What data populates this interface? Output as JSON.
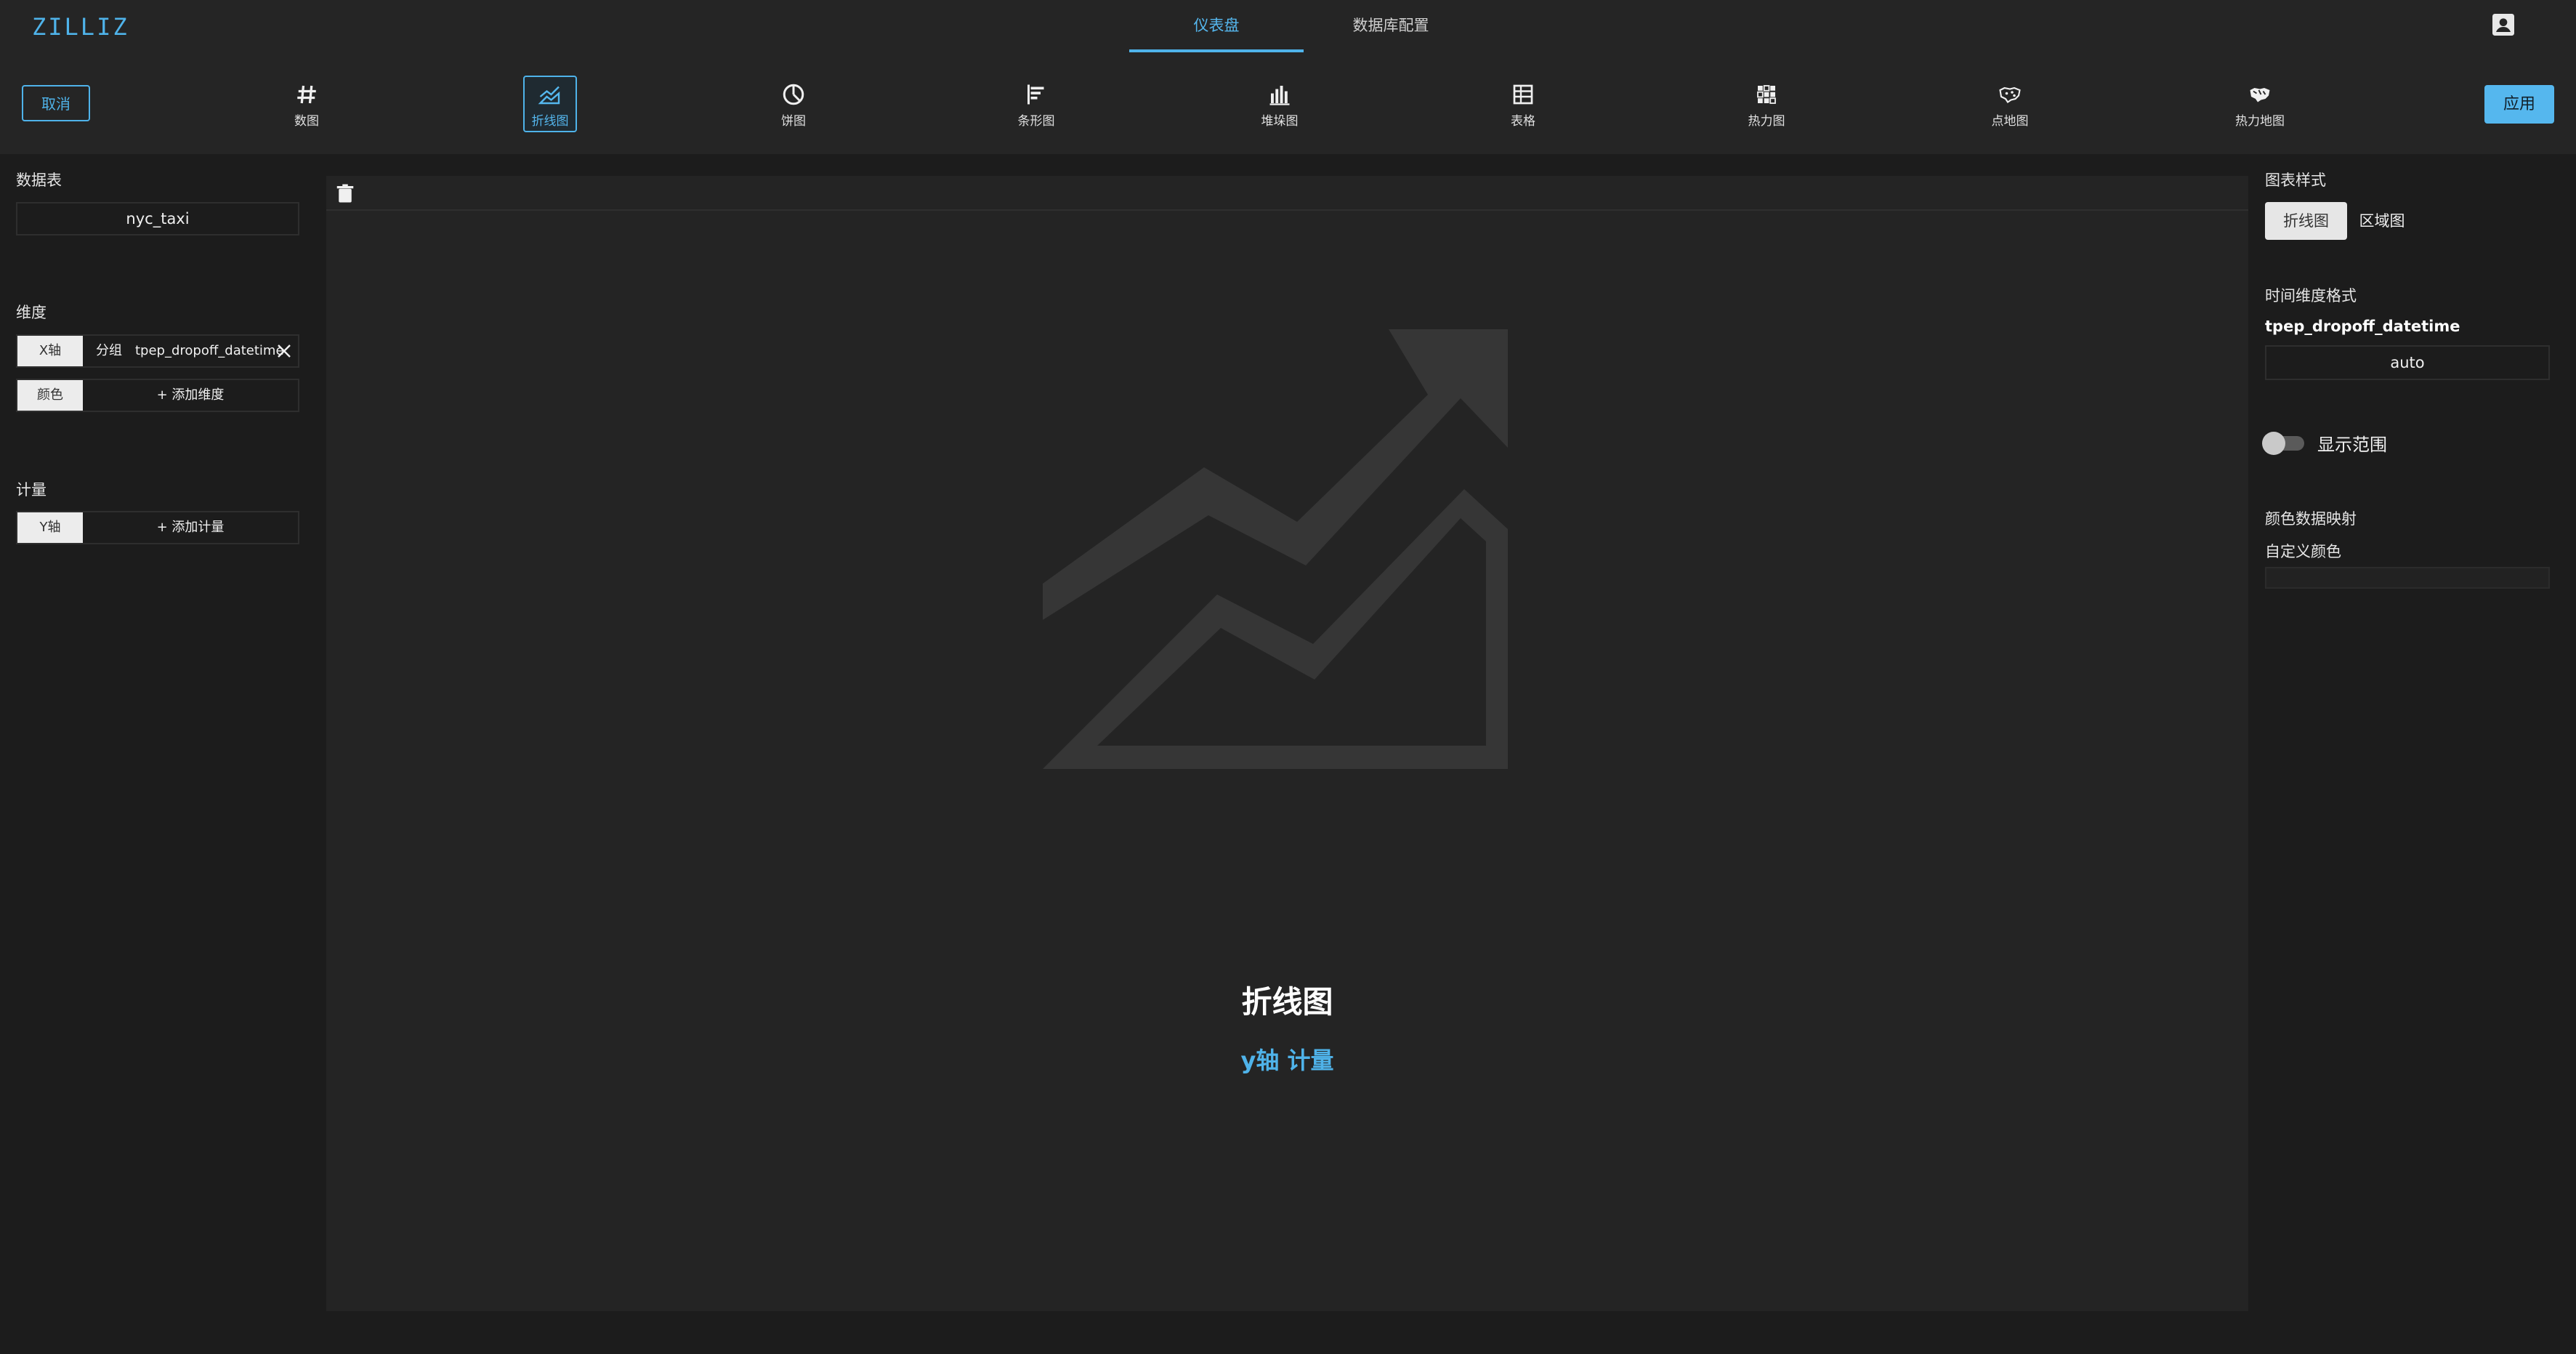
{
  "app": {
    "logo": "ZILLIZ"
  },
  "nav": {
    "tabs": [
      {
        "label": "仪表盘",
        "active": true
      },
      {
        "label": "数据库配置",
        "active": false
      }
    ]
  },
  "toolbar": {
    "cancel_label": "取消",
    "apply_label": "应用",
    "chart_types": [
      {
        "label": "数图",
        "icon": "hash-icon"
      },
      {
        "label": "折线图",
        "icon": "line-chart-icon",
        "active": true
      },
      {
        "label": "饼图",
        "icon": "pie-chart-icon"
      },
      {
        "label": "条形图",
        "icon": "bar-chart-icon"
      },
      {
        "label": "堆垛图",
        "icon": "stacked-chart-icon"
      },
      {
        "label": "表格",
        "icon": "table-icon"
      },
      {
        "label": "热力图",
        "icon": "heatmap-icon"
      },
      {
        "label": "点地图",
        "icon": "point-map-icon"
      },
      {
        "label": "热力地图",
        "icon": "heat-map-icon"
      }
    ]
  },
  "left": {
    "table_section_label": "数据表",
    "table_name": "nyc_taxi",
    "dimension_section_label": "维度",
    "x_axis_btn": "X轴",
    "x_group_label": "分组",
    "x_field": "tpep_dropoff_datetime",
    "color_btn": "颜色",
    "add_dimension": "+ 添加维度",
    "measure_section_label": "计量",
    "y_axis_btn": "Y轴",
    "add_measure": "+ 添加计量"
  },
  "canvas": {
    "title": "折线图",
    "subtitle": "y轴 计量"
  },
  "right": {
    "style_section_label": "图表样式",
    "style_options": [
      {
        "label": "折线图",
        "active": true
      },
      {
        "label": "区域图",
        "active": false
      }
    ],
    "time_format_label": "时间维度格式",
    "time_field": "tpep_dropoff_datetime",
    "time_format_value": "auto",
    "show_range_label": "显示范围",
    "show_range_on": false,
    "color_mapping_label": "颜色数据映射",
    "custom_color_label": "自定义颜色"
  },
  "colors": {
    "accent": "#4fb3ea",
    "background": "#1c1c1c",
    "panel": "#252525"
  }
}
